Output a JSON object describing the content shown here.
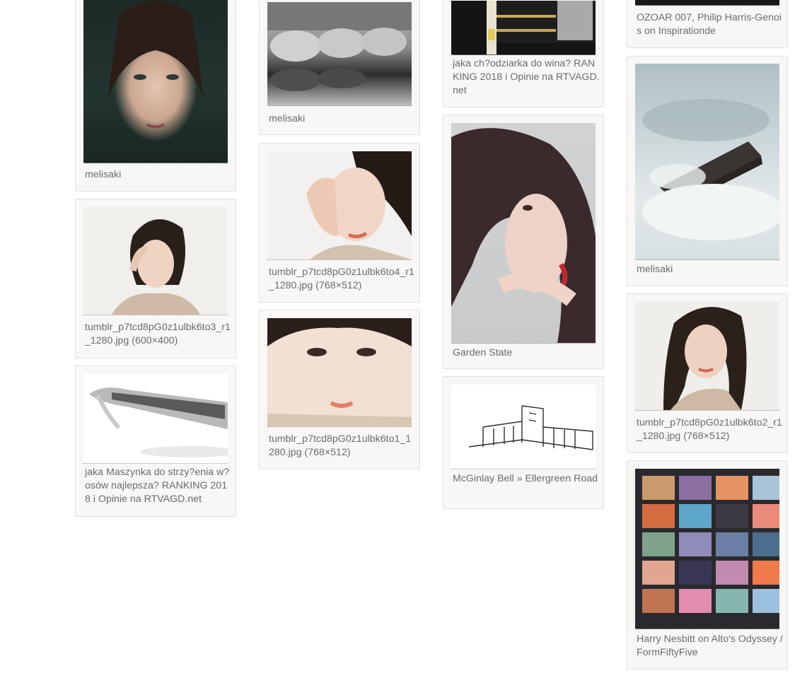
{
  "pins": [
    {
      "caption": "melisaki",
      "image": "portrait-redhead-photo"
    },
    {
      "caption": "tumblr_p7tcd8pG0z1ulbk6to3_r1_1280.jpg (600×400)",
      "image": "portrait-hand-on-cheek-photo"
    },
    {
      "caption": "jaka Maszynka do strzy?enia w?osów najlepsza? RANKING 2018 i Opinie na RTVAGD.net",
      "image": "hair-clipper-photo"
    },
    {
      "caption": "melisaki",
      "image": "vintage-beetle-cars-photo"
    },
    {
      "caption": "tumblr_p7tcd8pG0z1ulbk6to4_r1_1280.jpg (768×512)",
      "image": "portrait-hand-on-face-photo"
    },
    {
      "caption": "tumblr_p7tcd8pG0z1ulbk6to1_1280.jpg (768×512)",
      "image": "portrait-closeup-photo"
    },
    {
      "caption": "jaka ch?odziarka do wina? RANKING 2018 i Opinie na RTVAGD.net",
      "image": "wine-fridge-photo"
    },
    {
      "caption": "Garden State",
      "image": "portrait-red-lips-photo"
    },
    {
      "caption": "McGinlay Bell » Ellergreen Road",
      "image": "architecture-sketch"
    },
    {
      "caption": "OZOAR 007, Philip Harris-Genois on Inspirationde",
      "image": "dark-banner-photo"
    },
    {
      "caption": "melisaki",
      "image": "rock-in-mist-photo"
    },
    {
      "caption": "tumblr_p7tcd8pG0z1ulbk6to2_r1_1280.jpg (768×512)",
      "image": "portrait-shoulder-photo"
    },
    {
      "caption": "Harry Nesbitt on Alto′s Odyssey / FormFiftyFive",
      "image": "landscape-grid-illustration"
    }
  ]
}
